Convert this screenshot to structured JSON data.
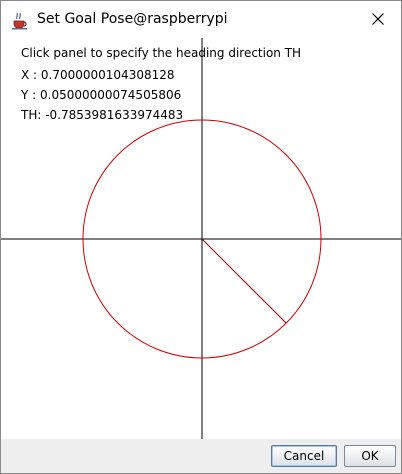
{
  "window": {
    "title": "Set Goal Pose@raspberrypi",
    "app_icon": "java-coffee-icon",
    "close_icon": "close-x-icon"
  },
  "panel": {
    "instruction": "Click panel to specify the heading direction TH",
    "x_line": "X : 0.7000000104308128",
    "y_line": "Y : 0.05000000074505806",
    "th_line": "TH: -0.7853981633974483",
    "heading_rad": -0.7853981633974483,
    "colors": {
      "circle": "#cc0000",
      "heading_line": "#990000",
      "axes": "#000000"
    }
  },
  "buttons": {
    "cancel_label": "Cancel",
    "ok_label": "OK"
  }
}
